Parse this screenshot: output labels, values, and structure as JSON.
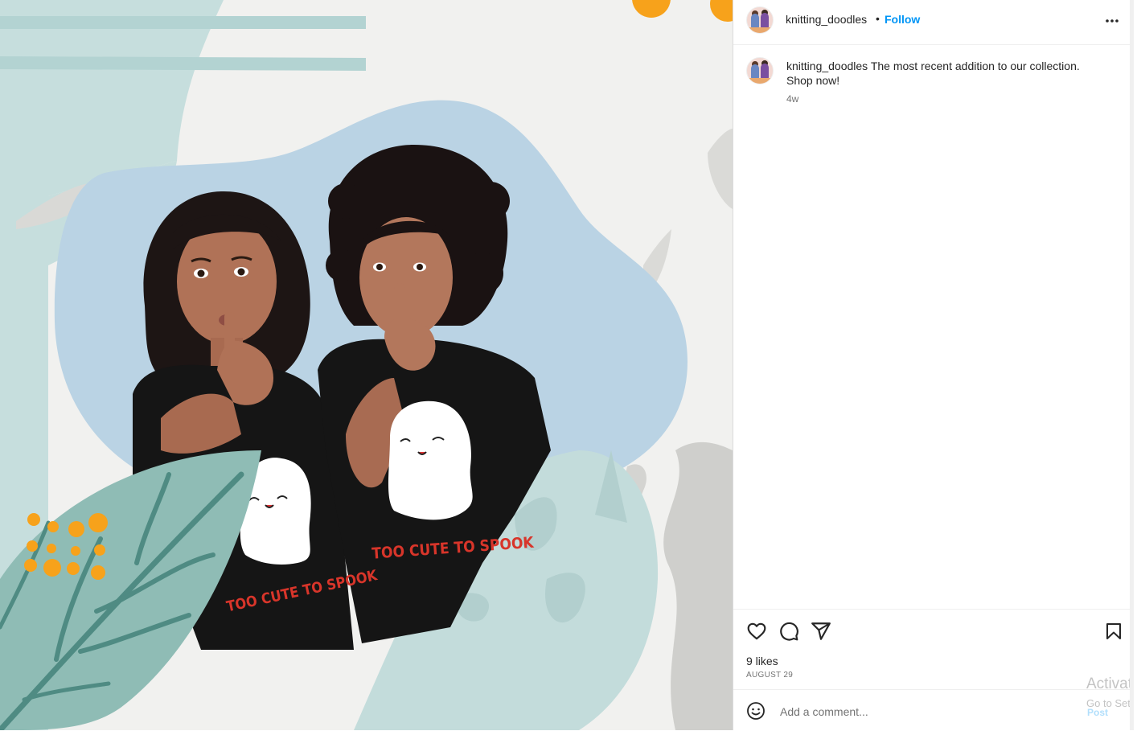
{
  "post": {
    "username": "knitting_doodles",
    "dot": "•",
    "follow_label": "Follow",
    "caption_user": "knitting_doodles",
    "caption_text": " The most recent addition to our collection. Shop now!",
    "time_ago": "4w",
    "likes": "9 likes",
    "date": "AUGUST 29"
  },
  "media": {
    "shirt_text_left": "TOO CUTE TO SPOOK",
    "shirt_text_right": "TOO CUTE TO SPOOK"
  },
  "comment": {
    "placeholder": "Add a comment...",
    "post_label": "Post"
  },
  "watermark": {
    "line1": "Activat",
    "line2": "Go to Set"
  },
  "icons": {
    "more": "more-options-icon",
    "like": "heart-icon",
    "comment": "comment-icon",
    "share": "share-icon",
    "save": "bookmark-icon",
    "emoji": "emoji-icon"
  },
  "colors": {
    "accent": "#0095f6",
    "post_disabled": "#b2dffc",
    "text": "#262626",
    "muted": "#737373"
  }
}
